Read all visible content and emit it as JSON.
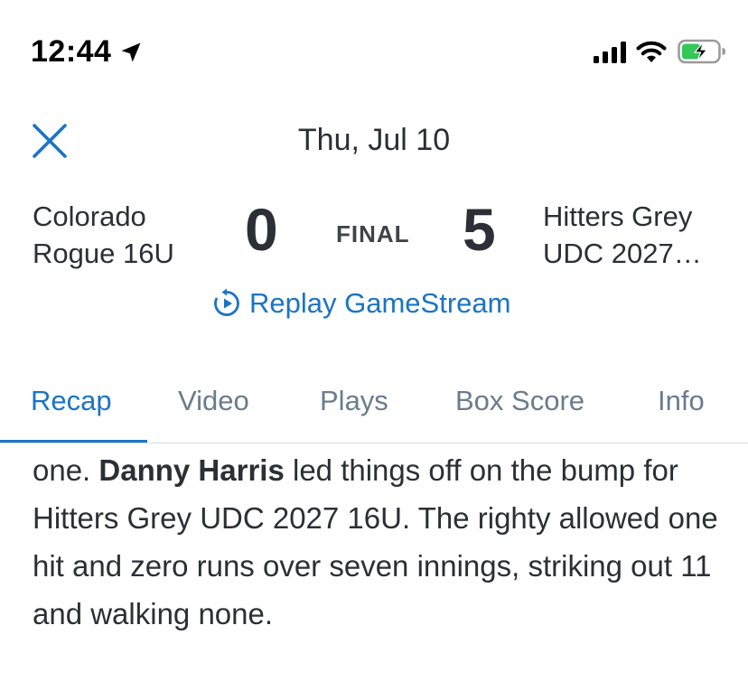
{
  "status_bar": {
    "time": "12:44",
    "icons": [
      "location-arrow-icon",
      "cellular-signal-icon",
      "wifi-icon",
      "battery-charging-icon"
    ],
    "battery_color": "#34c759"
  },
  "header": {
    "close_icon": "close-icon",
    "date": "Thu, Jul 10"
  },
  "game": {
    "home_team_line1": "Colorado",
    "home_team_line2": "Rogue 16U",
    "home_score": "0",
    "status": "FINAL",
    "away_score": "5",
    "away_team_line1": "Hitters Grey",
    "away_team_line2": "UDC 2027…",
    "replay_label": "Replay GameStream",
    "replay_icon": "replay-play-icon"
  },
  "tabs": [
    {
      "label": "Recap",
      "active": true
    },
    {
      "label": "Video",
      "active": false
    },
    {
      "label": "Plays",
      "active": false
    },
    {
      "label": "Box Score",
      "active": false
    },
    {
      "label": "Info",
      "active": false
    }
  ],
  "recap": {
    "text_before": "one. ",
    "highlight_name": "Danny Harris",
    "text_after": " led things off on the bump for Hitters Grey UDC 2027 16U. The righty allowed one hit and zero runs over seven innings, striking out 11 and walking none."
  },
  "colors": {
    "accent": "#1b74c5",
    "text": "#2c2f35",
    "tab_inactive": "#6a7c8d"
  }
}
